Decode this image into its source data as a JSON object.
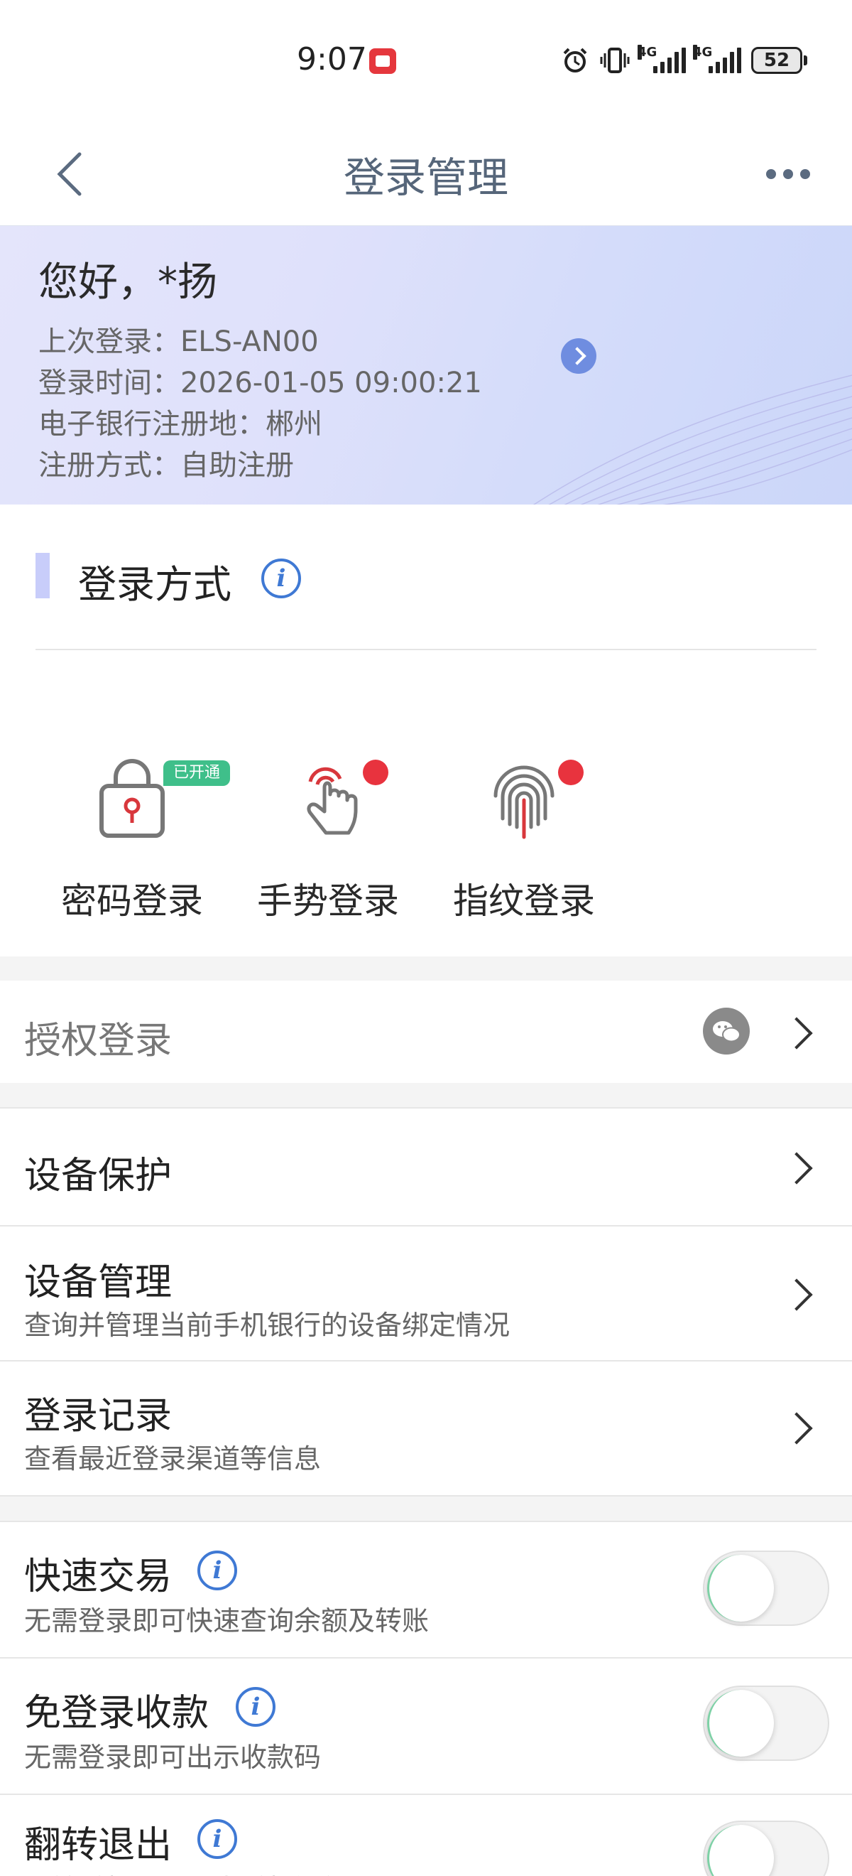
{
  "status_bar": {
    "time": "9:07",
    "battery": "52",
    "network_1": "4G",
    "network_2": "4G"
  },
  "header": {
    "title": "登录管理"
  },
  "banner": {
    "greeting": "您好，*扬",
    "last_login": "上次登录：ELS-AN00",
    "login_time": "登录时间：2026-01-05 09:00:21",
    "register_place": "电子银行注册地：郴州",
    "register_method": "注册方式：自助注册"
  },
  "login_methods": {
    "section_title": "登录方式",
    "items": [
      {
        "label": "密码登录",
        "badge": "已开通",
        "icon": "lock-icon"
      },
      {
        "label": "手势登录",
        "icon": "gesture-icon"
      },
      {
        "label": "指纹登录",
        "icon": "fingerprint-icon"
      }
    ]
  },
  "rows": {
    "auth_login": {
      "title": "授权登录"
    },
    "device_protect": {
      "title": "设备保护"
    },
    "device_manage": {
      "title": "设备管理",
      "subtitle": "查询并管理当前手机银行的设备绑定情况"
    },
    "login_record": {
      "title": "登录记录",
      "subtitle": "查看最近登录渠道等信息"
    },
    "quick_trade": {
      "title": "快速交易",
      "subtitle": "无需登录即可快速查询余额及转账",
      "enabled": false
    },
    "login_free_pay": {
      "title": "免登录收款",
      "subtitle": "无需登录即可出示收款码",
      "enabled": false
    },
    "flip_exit": {
      "title": "翻转退出",
      "subtitle": "翻转手机即可退出手机银行",
      "enabled": false
    }
  },
  "colors": {
    "accent_blue": "#3f79d4",
    "badge_green": "#3fbf8a",
    "alert_red": "#e8333e",
    "title_gray": "#56667a"
  }
}
